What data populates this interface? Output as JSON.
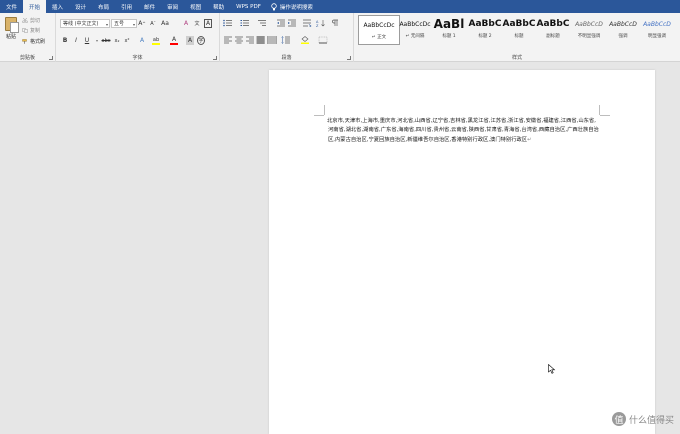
{
  "tabs": [
    {
      "label": "文件"
    },
    {
      "label": "开始"
    },
    {
      "label": "插入"
    },
    {
      "label": "设计"
    },
    {
      "label": "布局"
    },
    {
      "label": "引用"
    },
    {
      "label": "邮件"
    },
    {
      "label": "审阅"
    },
    {
      "label": "视图"
    },
    {
      "label": "帮助"
    },
    {
      "label": "WPS PDF"
    }
  ],
  "tell_me": "操作说明搜索",
  "clipboard": {
    "paste": "粘贴",
    "cut": "剪切",
    "copy": "复制",
    "format_painter": "格式刷",
    "label": "剪贴板"
  },
  "font": {
    "font_name": "等线 (中文正文)",
    "font_size": "五号",
    "grow": "A",
    "shrink": "A",
    "case": "Aa",
    "clear": "A",
    "phonetic": "文",
    "border": "A",
    "bold": "B",
    "italic": "I",
    "underline": "U",
    "strike": "abc",
    "subscript": "x₂",
    "superscript": "x²",
    "effects": "A",
    "highlight": "ab",
    "color": "A",
    "shade": "A",
    "circle": "字",
    "label": "字体"
  },
  "paragraph": {
    "label": "段落"
  },
  "styles": {
    "label": "样式",
    "items": [
      {
        "preview": "AaBbCcDc",
        "name": "↵ 正文"
      },
      {
        "preview": "AaBbCcDc",
        "name": "↵ 无间隔"
      },
      {
        "preview": "AaBl",
        "name": "标题 1"
      },
      {
        "preview": "AaBbC",
        "name": "标题 2"
      },
      {
        "preview": "AaBbC",
        "name": "标题"
      },
      {
        "preview": "AaBbC",
        "name": "副标题"
      },
      {
        "preview": "AaBbCcD",
        "name": "不明显强调"
      },
      {
        "preview": "AaBbCcD",
        "name": "强调"
      },
      {
        "preview": "AaBbCcD",
        "name": "明显强调"
      }
    ]
  },
  "document": {
    "body": "北京市,天津市,上海市,重庆市,河北省,山西省,辽宁省,吉林省,黑龙江省,江苏省,浙江省,安徽省,福建省,江西省,山东省,河南省,湖北省,湖南省,广东省,海南省,四川省,贵州省,云南省,陕西省,甘肃省,青海省,台湾省,西藏自治区,广西壮族自治区,内蒙古自治区,宁夏回族自治区,新疆维吾尔自治区,香港特别行政区,澳门特别行政区",
    "para_mark": "↵"
  },
  "watermark": {
    "badge": "值",
    "text": "什么值得买"
  },
  "colors": {
    "accent": "#2b579a",
    "ribbon_bg": "#f3f3f3",
    "workspace_bg": "#e6e6e6",
    "font_color_bar": "#ff0000",
    "highlight_bar": "#ffff00"
  }
}
